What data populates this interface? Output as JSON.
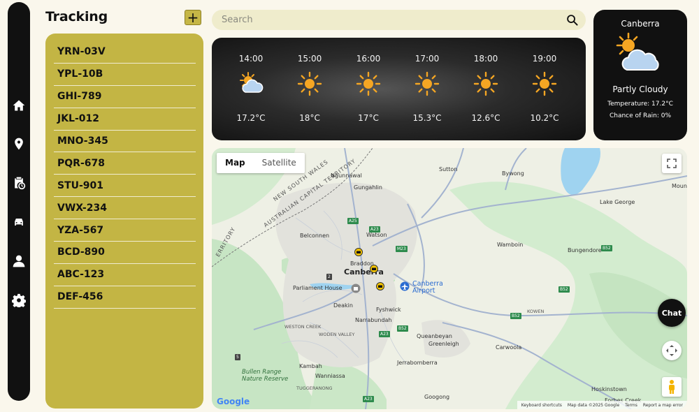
{
  "sidebar": {
    "items": [
      {
        "name": "home-icon"
      },
      {
        "name": "location-pin-icon"
      },
      {
        "name": "schedule-clipboard-icon"
      },
      {
        "name": "car-icon"
      },
      {
        "name": "user-icon"
      },
      {
        "name": "gear-icon"
      }
    ]
  },
  "tracking": {
    "title": "Tracking",
    "add_label": "+",
    "vehicles": [
      "YRN-03V",
      "YPL-10B",
      "GHI-789",
      "JKL-012",
      "MNO-345",
      "PQR-678",
      "STU-901",
      "VWX-234",
      "YZA-567",
      "BCD-890",
      "ABC-123",
      "DEF-456"
    ]
  },
  "search": {
    "placeholder": "Search",
    "value": "",
    "icon": "search-icon"
  },
  "forecast": {
    "hours": [
      {
        "time": "14:00",
        "icon": "partly-cloudy-icon",
        "temp": "17.2°C"
      },
      {
        "time": "15:00",
        "icon": "sun-icon",
        "temp": "18°C"
      },
      {
        "time": "16:00",
        "icon": "sun-icon",
        "temp": "17°C"
      },
      {
        "time": "17:00",
        "icon": "sun-icon",
        "temp": "15.3°C"
      },
      {
        "time": "18:00",
        "icon": "sun-icon",
        "temp": "12.6°C"
      },
      {
        "time": "19:00",
        "icon": "sun-icon",
        "temp": "10.2°C"
      }
    ]
  },
  "current": {
    "city": "Canberra",
    "icon": "partly-cloudy-icon",
    "condition": "Partly Cloudy",
    "temperature": "Temperature: 17.2°C",
    "rain": "Chance of Rain: 0%"
  },
  "map": {
    "tabs": [
      "Map",
      "Satellite"
    ],
    "active_tab": "Map",
    "labels": {
      "canberra": "Canberra",
      "parliament": "Parliament House",
      "airport": "Canberra\nAirport",
      "belconnen": "Belconnen",
      "gungahlin": "Gungahlin",
      "ngunnawal": "Ngunnawal",
      "sutton": "Sutton",
      "bywong": "Bywong",
      "lake_george": "Lake George",
      "wamboin": "Wamboin",
      "bungendore": "Bungendore",
      "watson": "Watson",
      "braddon": "Braddon",
      "deakin": "Deakin",
      "fyshwick": "Fyshwick",
      "narrabundah": "Narrabundah",
      "queanbeyan": "Queanbeyan",
      "greenleigh": "Greenleigh",
      "carwoola": "Carwoola",
      "kowen": "KOWEN",
      "weston_creek": "WESTON CREEK",
      "woden_valley": "WODEN VALLEY",
      "bullen_range": "Bullen Range\nNature Reserve",
      "kambah": "Kambah",
      "wanniassa": "Wanniassa",
      "jerrabomberra": "Jerrabomberra",
      "tuggeranong": "TUGGERANONG",
      "googong": "Googong",
      "hoskinstown": "Hoskinstown",
      "forbes_creek": "Forbes Creek",
      "nsw": "NEW SOUTH WALES",
      "act": "AUSTRALIAN CAPITAL TERRITORY",
      "territory": "ERRITORY",
      "mount": "Mount"
    },
    "roads": [
      "A25",
      "A23",
      "M23",
      "B52",
      "A23",
      "B52",
      "B52",
      "B52",
      "A23",
      "2",
      "5"
    ],
    "footer": [
      "Keyboard shortcuts",
      "Map data ©2025 Google",
      "Terms",
      "Report a map error"
    ],
    "google": "Google",
    "chat_label": "Chat",
    "colors": {
      "water": "#9fd3f0",
      "park": "#c7e5c4",
      "roads": "#a3b3cf",
      "urban": "#e6e6e6"
    }
  }
}
